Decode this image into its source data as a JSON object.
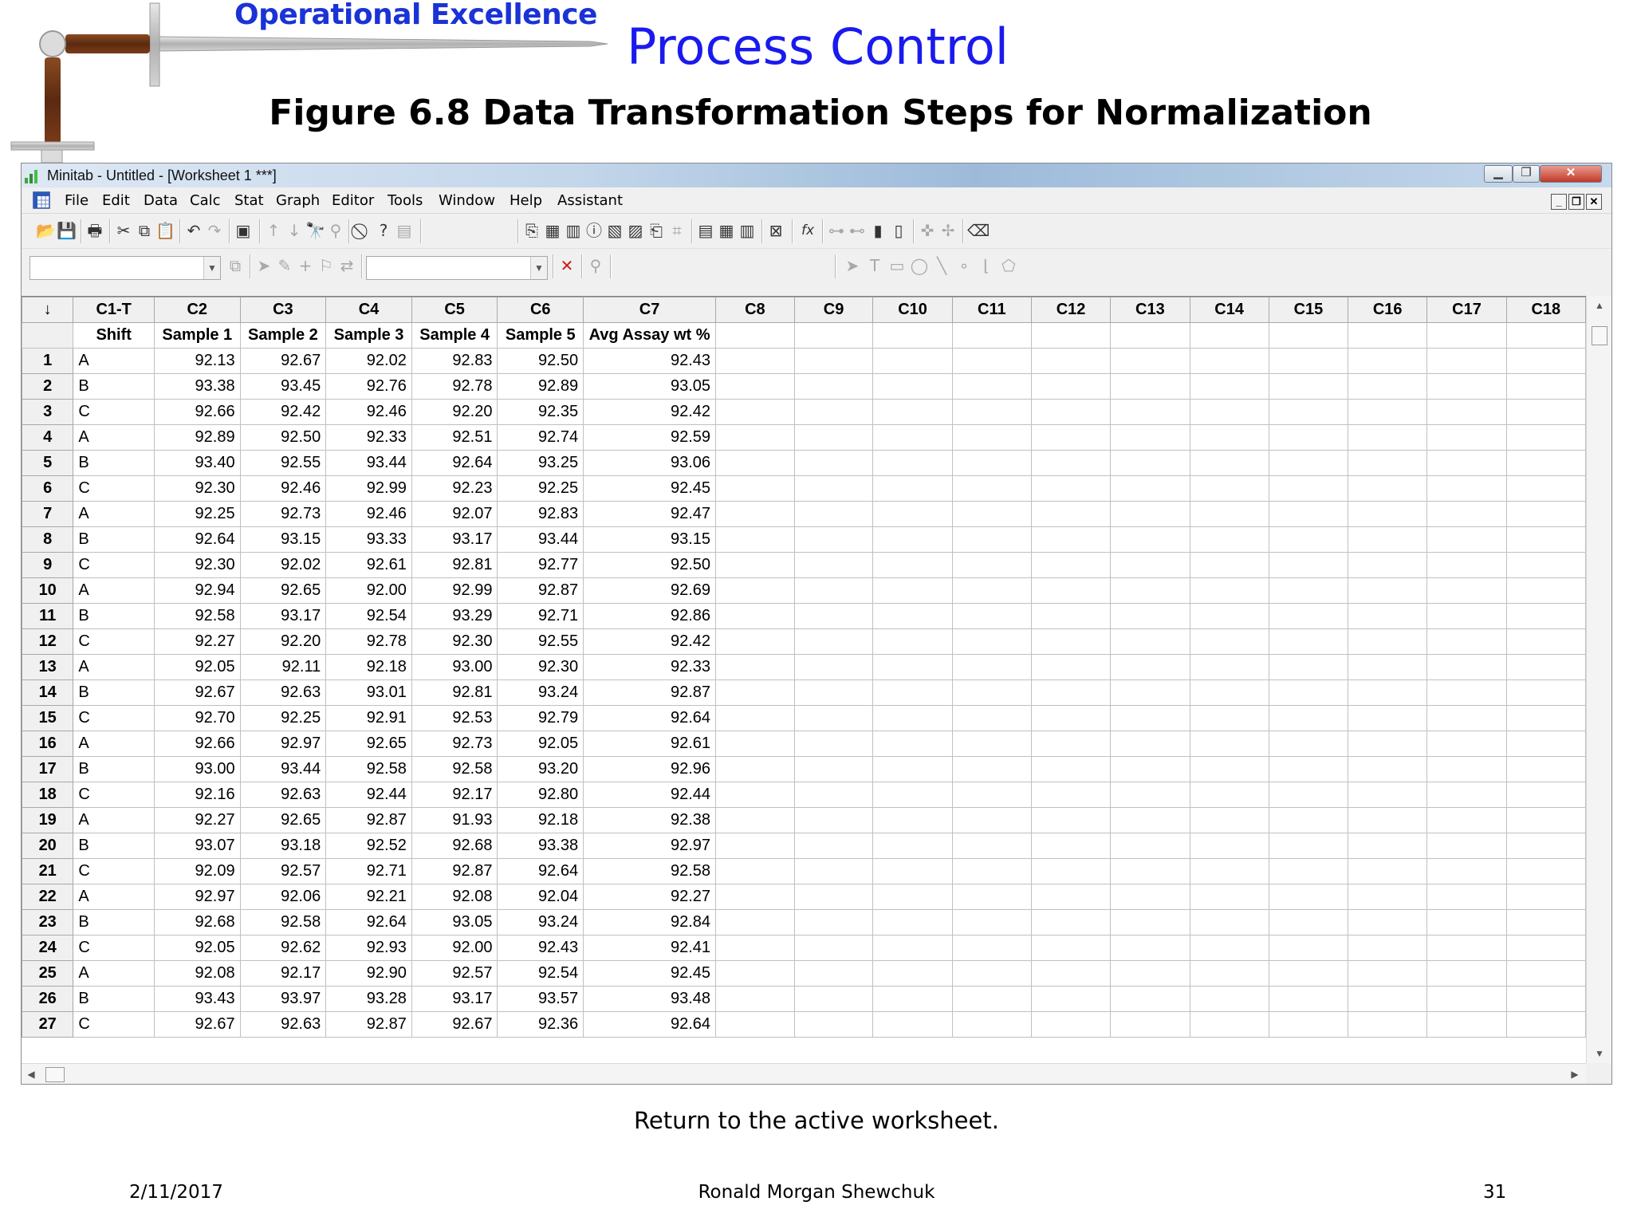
{
  "slide": {
    "brand": "Operational Excellence",
    "title": "Process Control",
    "subtitle": "Figure 6.8  Data Transformation Steps for Normalization",
    "caption": "Return to the active worksheet.",
    "footer_date": "2/11/2017",
    "footer_author": "Ronald Morgan Shewchuk",
    "footer_page": "31"
  },
  "window": {
    "title": "Minitab - Untitled - [Worksheet 1 ***]",
    "menu": [
      "File",
      "Edit",
      "Data",
      "Calc",
      "Stat",
      "Graph",
      "Editor",
      "Tools",
      "Window",
      "Help",
      "Assistant"
    ]
  },
  "icons": {
    "toolbar1": [
      "open-icon",
      "save-icon",
      "print-icon",
      "cut-icon",
      "copy-icon",
      "paste-icon",
      "undo-icon",
      "redo-icon",
      "edit-last-dialog-icon",
      "previous-icon",
      "next-icon",
      "find-icon",
      "replace-icon",
      "cancel-icon",
      "help-icon",
      "stat-guide-icon",
      "session-icon",
      "worksheet-icon",
      "project-manager-icon",
      "info-icon",
      "history-icon",
      "graph-folder-icon",
      "related-docs-icon",
      "design-icon",
      "reports-icon",
      "show-worksheets-icon",
      "show-graphs-icon",
      "close-graphs-icon",
      "formula-icon",
      "insert-cells-icon",
      "insert-rows-icon",
      "insert-columns-icon",
      "move-columns-icon",
      "disabled-a-icon",
      "disabled-b-icon",
      "clear-icon"
    ],
    "toolbar2": [
      "select-pointer-icon",
      "brush-icon",
      "crosshair-icon",
      "flag-icon",
      "swap-icon",
      "delete-x-icon",
      "zoom-icon",
      "arrow-tool-icon",
      "text-tool-icon",
      "rectangle-tool-icon",
      "ellipse-tool-icon",
      "line-tool-icon",
      "marker-tool-icon",
      "polyline-tool-icon",
      "polygon-tool-icon"
    ]
  },
  "worksheet": {
    "corner": "↓",
    "columns": [
      "C1-T",
      "C2",
      "C3",
      "C4",
      "C5",
      "C6",
      "C7",
      "C8",
      "C9",
      "C10",
      "C11",
      "C12",
      "C13",
      "C14",
      "C15",
      "C16",
      "C17",
      "C18"
    ],
    "names": [
      "Shift",
      "Sample 1",
      "Sample 2",
      "Sample 3",
      "Sample 4",
      "Sample 5",
      "Avg Assay wt %",
      "",
      "",
      "",
      "",
      "",
      "",
      "",
      "",
      "",
      "",
      ""
    ],
    "rows": [
      [
        "1",
        "A",
        "92.13",
        "92.67",
        "92.02",
        "92.83",
        "92.50",
        "92.43"
      ],
      [
        "2",
        "B",
        "93.38",
        "93.45",
        "92.76",
        "92.78",
        "92.89",
        "93.05"
      ],
      [
        "3",
        "C",
        "92.66",
        "92.42",
        "92.46",
        "92.20",
        "92.35",
        "92.42"
      ],
      [
        "4",
        "A",
        "92.89",
        "92.50",
        "92.33",
        "92.51",
        "92.74",
        "92.59"
      ],
      [
        "5",
        "B",
        "93.40",
        "92.55",
        "93.44",
        "92.64",
        "93.25",
        "93.06"
      ],
      [
        "6",
        "C",
        "92.30",
        "92.46",
        "92.99",
        "92.23",
        "92.25",
        "92.45"
      ],
      [
        "7",
        "A",
        "92.25",
        "92.73",
        "92.46",
        "92.07",
        "92.83",
        "92.47"
      ],
      [
        "8",
        "B",
        "92.64",
        "93.15",
        "93.33",
        "93.17",
        "93.44",
        "93.15"
      ],
      [
        "9",
        "C",
        "92.30",
        "92.02",
        "92.61",
        "92.81",
        "92.77",
        "92.50"
      ],
      [
        "10",
        "A",
        "92.94",
        "92.65",
        "92.00",
        "92.99",
        "92.87",
        "92.69"
      ],
      [
        "11",
        "B",
        "92.58",
        "93.17",
        "92.54",
        "93.29",
        "92.71",
        "92.86"
      ],
      [
        "12",
        "C",
        "92.27",
        "92.20",
        "92.78",
        "92.30",
        "92.55",
        "92.42"
      ],
      [
        "13",
        "A",
        "92.05",
        "92.11",
        "92.18",
        "93.00",
        "92.30",
        "92.33"
      ],
      [
        "14",
        "B",
        "92.67",
        "92.63",
        "93.01",
        "92.81",
        "93.24",
        "92.87"
      ],
      [
        "15",
        "C",
        "92.70",
        "92.25",
        "92.91",
        "92.53",
        "92.79",
        "92.64"
      ],
      [
        "16",
        "A",
        "92.66",
        "92.97",
        "92.65",
        "92.73",
        "92.05",
        "92.61"
      ],
      [
        "17",
        "B",
        "93.00",
        "93.44",
        "92.58",
        "92.58",
        "93.20",
        "92.96"
      ],
      [
        "18",
        "C",
        "92.16",
        "92.63",
        "92.44",
        "92.17",
        "92.80",
        "92.44"
      ],
      [
        "19",
        "A",
        "92.27",
        "92.65",
        "92.87",
        "91.93",
        "92.18",
        "92.38"
      ],
      [
        "20",
        "B",
        "93.07",
        "93.18",
        "92.52",
        "92.68",
        "93.38",
        "92.97"
      ],
      [
        "21",
        "C",
        "92.09",
        "92.57",
        "92.71",
        "92.87",
        "92.64",
        "92.58"
      ],
      [
        "22",
        "A",
        "92.97",
        "92.06",
        "92.21",
        "92.08",
        "92.04",
        "92.27"
      ],
      [
        "23",
        "B",
        "92.68",
        "92.58",
        "92.64",
        "93.05",
        "93.24",
        "92.84"
      ],
      [
        "24",
        "C",
        "92.05",
        "92.62",
        "92.93",
        "92.00",
        "92.43",
        "92.41"
      ],
      [
        "25",
        "A",
        "92.08",
        "92.17",
        "92.90",
        "92.57",
        "92.54",
        "92.45"
      ],
      [
        "26",
        "B",
        "93.43",
        "93.97",
        "93.28",
        "93.17",
        "93.57",
        "93.48"
      ],
      [
        "27",
        "C",
        "92.67",
        "92.63",
        "92.87",
        "92.67",
        "92.36",
        "92.64"
      ]
    ]
  },
  "colors": {
    "brand": "#1a33d6",
    "title": "#1a1aee",
    "window_chrome": "#f0f0f0",
    "close_button": "#c13a27"
  }
}
